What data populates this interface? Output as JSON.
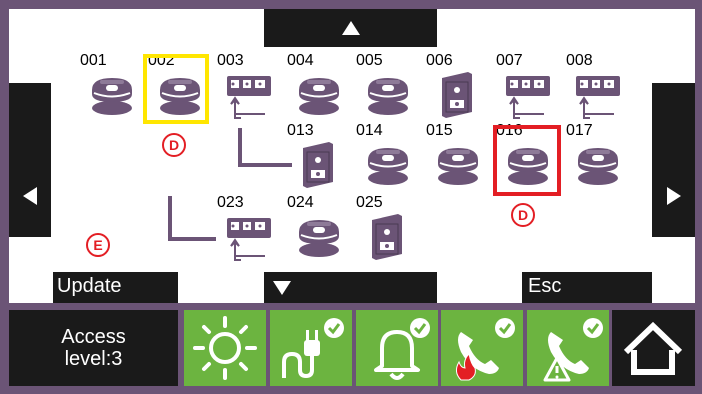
{
  "devices": [
    {
      "id": "001",
      "type": "smoke"
    },
    {
      "id": "002",
      "type": "smoke"
    },
    {
      "id": "003",
      "type": "module"
    },
    {
      "id": "004",
      "type": "smoke"
    },
    {
      "id": "005",
      "type": "smoke"
    },
    {
      "id": "006",
      "type": "box"
    },
    {
      "id": "007",
      "type": "module"
    },
    {
      "id": "008",
      "type": "module"
    },
    {
      "id": "013",
      "type": "box"
    },
    {
      "id": "014",
      "type": "smoke"
    },
    {
      "id": "015",
      "type": "smoke"
    },
    {
      "id": "016",
      "type": "smoke"
    },
    {
      "id": "017",
      "type": "smoke"
    },
    {
      "id": "023",
      "type": "module"
    },
    {
      "id": "024",
      "type": "smoke"
    },
    {
      "id": "025",
      "type": "box"
    }
  ],
  "badges": {
    "d1": "D",
    "d2": "D",
    "e": "E"
  },
  "buttons": {
    "update": "Update",
    "esc": "Esc"
  },
  "access": {
    "line1": "Access",
    "line2": "level:3"
  },
  "colors": {
    "frame": "#6b5476",
    "green": "#6cb440",
    "device": "#6b5476",
    "selected_yellow": "#ffe600",
    "selected_red": "#e31e24"
  },
  "icons": {
    "scroll_up": "triangle-up-icon",
    "scroll_down": "triangle-down-icon",
    "scroll_left": "triangle-left-icon",
    "scroll_right": "triangle-right-icon",
    "tile1": "sun-icon",
    "tile2": "power-plug-check-icon",
    "tile3": "bell-check-icon",
    "tile4": "phone-fire-check-icon",
    "tile5": "phone-warning-check-icon",
    "home": "home-icon"
  }
}
